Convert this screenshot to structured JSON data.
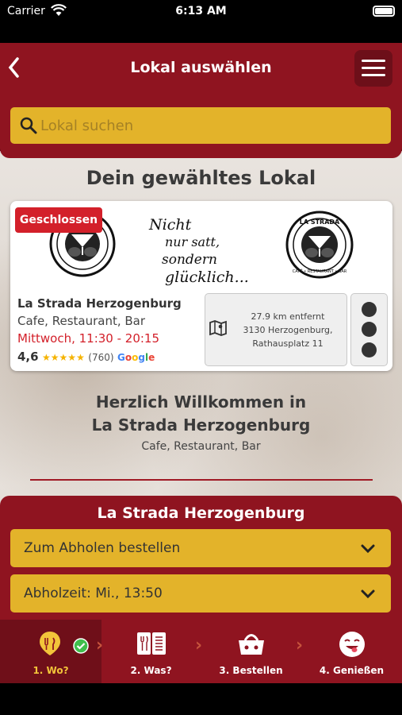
{
  "status_bar": {
    "carrier": "Carrier",
    "time": "6:13 AM"
  },
  "header": {
    "title": "Lokal auswählen",
    "back_icon": "back-chevron-icon",
    "menu_icon": "hamburger-menu-icon"
  },
  "search": {
    "placeholder": "Lokal suchen"
  },
  "section_title": "Dein gewähltes Lokal",
  "restaurant": {
    "status_badge": "Geschlossen",
    "logo_text": "LA STRADA",
    "logo_subtext": "CAFÉ • RESTAURANT • BAR",
    "slogan": [
      "Nicht",
      "nur satt,",
      "sondern",
      "glücklich..."
    ],
    "name": "La Strada Herzogenburg",
    "type": "Cafe, Restaurant, Bar",
    "hours": "Mittwoch, 11:30 - 20:15",
    "rating": "4,6",
    "stars": "★★★★★",
    "review_count": "(760)",
    "google_letters": [
      "G",
      "o",
      "o",
      "g",
      "l",
      "e"
    ],
    "distance": "27.9 km entfernt",
    "address_line1": "3130 Herzogenburg,",
    "address_line2": "Rathausplatz 11"
  },
  "welcome": {
    "line1": "Herzlich Willkommen in",
    "line2": "La Strada Herzogenburg",
    "line3": "Cafe, Restaurant, Bar"
  },
  "order": {
    "title": "La Strada Herzogenburg",
    "mode": "Zum Abholen bestellen",
    "pickup_time": "Abholzeit: Mi., 13:50"
  },
  "nav": {
    "items": [
      {
        "label": "1. Wo?",
        "icon": "location-pin-icon"
      },
      {
        "label": "2. Was?",
        "icon": "menu-book-icon"
      },
      {
        "label": "3. Bestellen",
        "icon": "basket-icon"
      },
      {
        "label": "4. Genießen",
        "icon": "smiley-face-icon"
      }
    ],
    "separator": "›"
  },
  "colors": {
    "brand_red": "#8f1420",
    "accent_yellow": "#e3b32a",
    "closed_red": "#d3202a",
    "google": [
      "#4285F4",
      "#EA4335",
      "#FBBC05",
      "#4285F4",
      "#34A853",
      "#EA4335"
    ]
  }
}
